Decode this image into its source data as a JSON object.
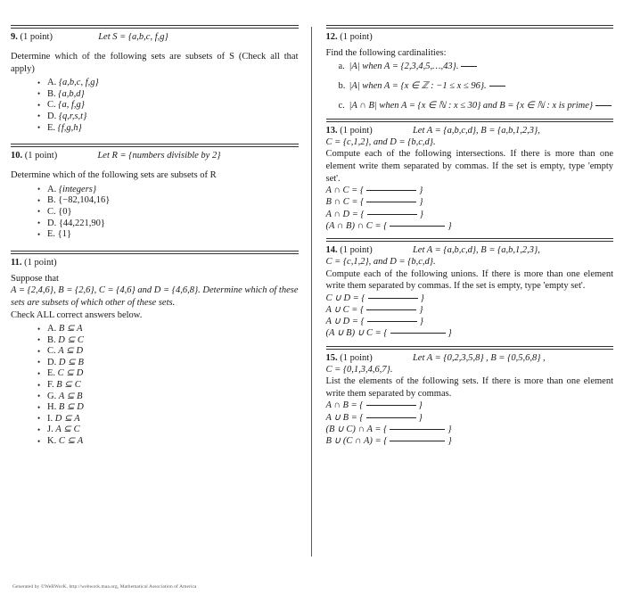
{
  "document": {
    "footer": "Generated by ©WeBWorK, http://webwork.maa.org, Mathematical Association of America"
  },
  "left_column": {
    "problems": [
      {
        "number": "9.",
        "points": "(1 point)",
        "head_math": "Let S = {a,b,c, f,g}",
        "prompt": "Determine which of the following sets are subsets of S (Check all that apply)",
        "options": [
          {
            "label": "A.",
            "text": "{a,b,c, f,g}"
          },
          {
            "label": "B.",
            "text": "{a,b,d}"
          },
          {
            "label": "C.",
            "text": "{a, f,g}"
          },
          {
            "label": "D.",
            "text": "{q,r,s,t}"
          },
          {
            "label": "E.",
            "text": "{f,g,h}"
          }
        ]
      },
      {
        "number": "10.",
        "points": "(1 point)",
        "head_math": "Let R = {numbers divisible by 2}",
        "prompt": "Determine which of the following sets are subsets of R",
        "options": [
          {
            "label": "A.",
            "text": "{integers}"
          },
          {
            "label": "B.",
            "text": "{−82,104,16}"
          },
          {
            "label": "C.",
            "text": "{0}"
          },
          {
            "label": "D.",
            "text": "{44,221,90}"
          },
          {
            "label": "E.",
            "text": "{1}"
          }
        ]
      },
      {
        "number": "11.",
        "points": "(1 point)",
        "line1": "Suppose that",
        "line2": "A = {2,4,6}, B = {2,6}, C = {4,6} and D = {4,6,8}. Determine which of these sets are subsets of which other of these sets.",
        "line3": "Check ALL correct answers below.",
        "options": [
          {
            "label": "A.",
            "text": "B ⊆ A"
          },
          {
            "label": "B.",
            "text": "D ⊆ C"
          },
          {
            "label": "C.",
            "text": "A ⊆ D"
          },
          {
            "label": "D.",
            "text": "D ⊆ B"
          },
          {
            "label": "E.",
            "text": "C ⊆ D"
          },
          {
            "label": "F.",
            "text": "B ⊆ C"
          },
          {
            "label": "G.",
            "text": "A ⊆ B"
          },
          {
            "label": "H.",
            "text": "B ⊆ D"
          },
          {
            "label": "I.",
            "text": "D ⊆ A"
          },
          {
            "label": "J.",
            "text": "A ⊆ C"
          },
          {
            "label": "K.",
            "text": "C ⊆ A"
          }
        ]
      }
    ]
  },
  "right_column": {
    "problems": [
      {
        "number": "12.",
        "points": "(1 point)",
        "prompt": "Find the following cardinalities:",
        "parts": [
          {
            "label": "a.",
            "text": "|A| when A = {2,3,4,5,…,43}."
          },
          {
            "label": "b.",
            "text": "|A| when A = {x ∈ ℤ : −1 ≤ x ≤ 96}."
          },
          {
            "label": "c.",
            "text": "|A ∩ B| when A = {x ∈ ℕ : x ≤ 30} and B = {x ∈ ℕ : x is prime}"
          }
        ]
      },
      {
        "number": "13.",
        "points": "(1 point)",
        "head_math": "Let A = {a,b,c,d},  B = {a,b,1,2,3},",
        "line2": "C = {c,1,2},  and D = {b,c,d}.",
        "prompt": "Compute each of the following intersections. If there is more than one element write them separated by commas. If the set is empty, type 'empty set'.",
        "equations": [
          "A ∩ C = {",
          "B ∩ C = {",
          "A ∩ D = {",
          "(A ∩ B) ∩ C = {"
        ]
      },
      {
        "number": "14.",
        "points": "(1 point)",
        "head_math": "Let A = {a,b,c,d},  B = {a,b,1,2,3},",
        "line2": "C = {c,1,2},  and D = {b,c,d}.",
        "prompt": "Compute each of the following unions. If there is more than one element write them separated by commas. If the set is empty, type 'empty set'.",
        "equations": [
          "C ∪ D = {",
          "A ∪ C = {",
          "A ∪ D = {",
          "(A ∪ B) ∪ C = {"
        ]
      },
      {
        "number": "15.",
        "points": "(1 point)",
        "head_math": "Let A = {0,2,3,5,8} , B = {0,5,6,8} ,",
        "line2": "C = {0,1,3,4,6,7}.",
        "prompt": "List the elements of the following sets. If there is more than one element write them separated by commas.",
        "equations": [
          "A ∩ B = {",
          "A ∪ B = {",
          "(B ∪ C) ∩ A = {",
          "B ∪ (C ∩ A) = {"
        ]
      }
    ]
  }
}
